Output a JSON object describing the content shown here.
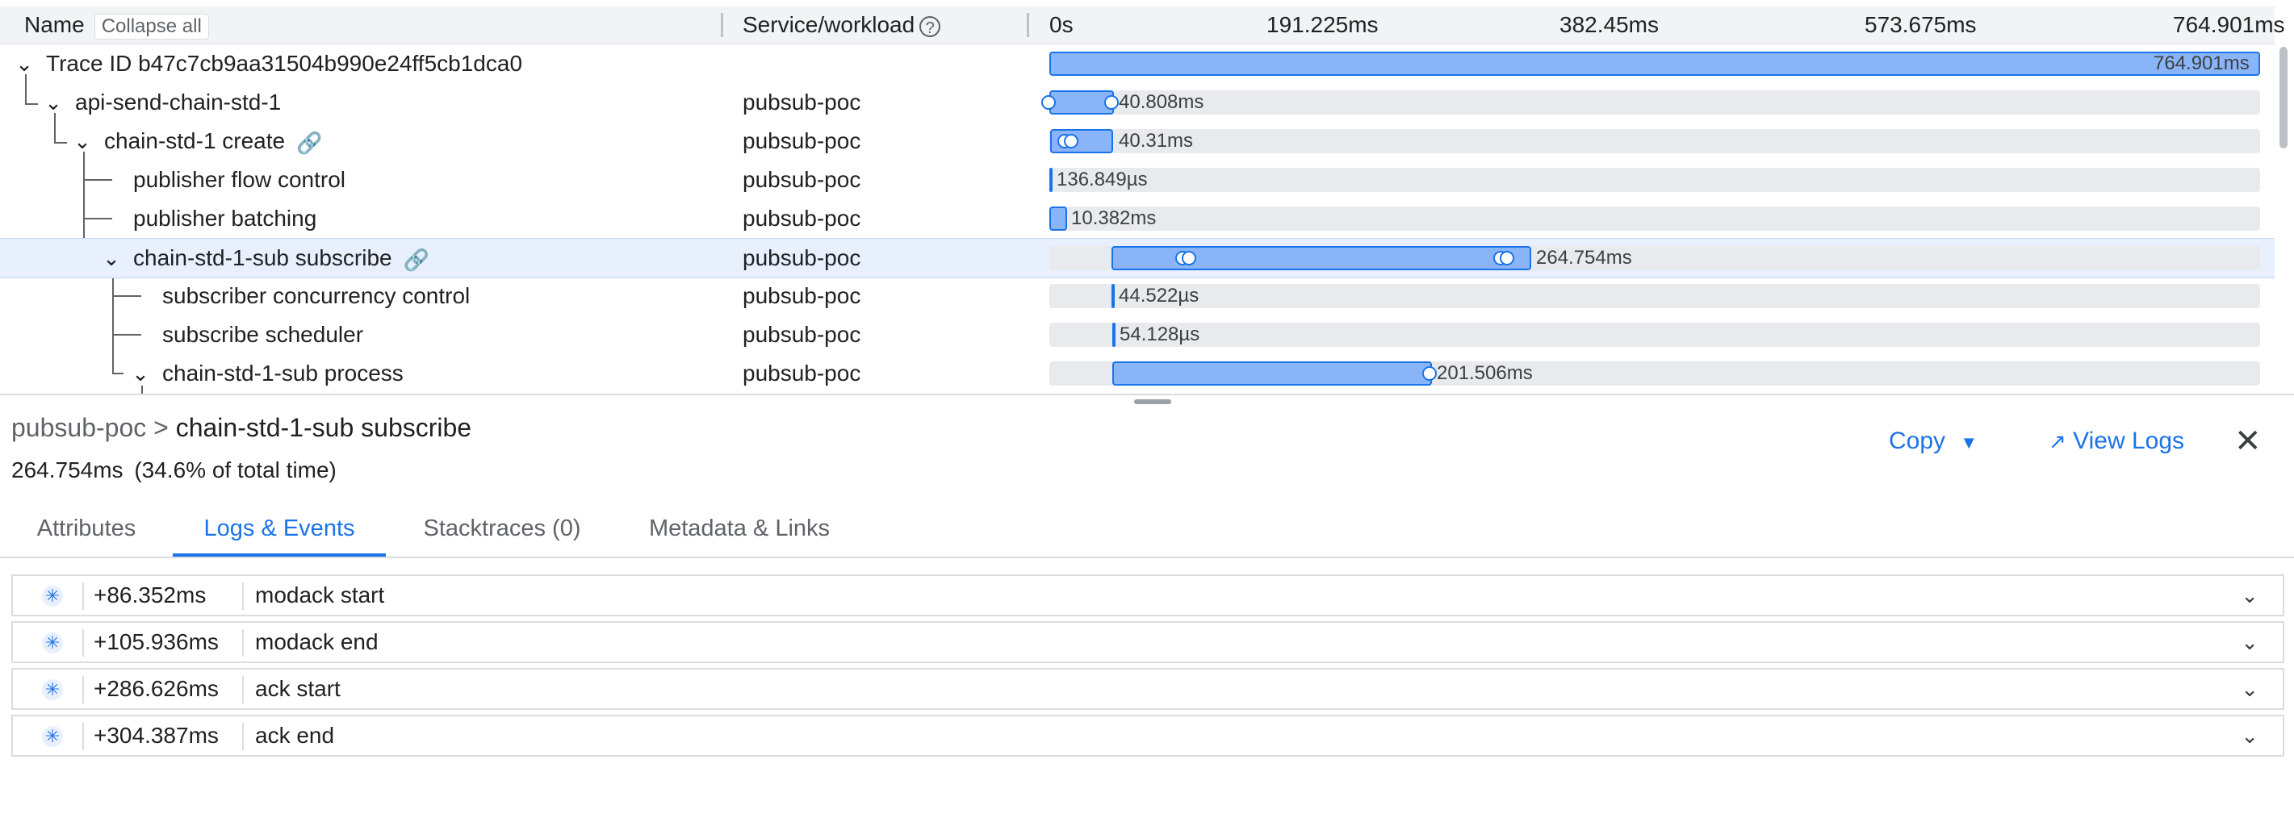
{
  "header": {
    "name_col": "Name",
    "collapse_all": "Collapse all",
    "service_col": "Service/workload",
    "help": "?",
    "ticks": [
      "0s",
      "191.225ms",
      "382.45ms",
      "573.675ms",
      "764.901ms"
    ]
  },
  "rows": [
    {
      "name": "Trace ID b47c7cb9aa31504b990e24ff5cb1dca0",
      "service": "",
      "duration": "764.901ms"
    },
    {
      "name": "api-send-chain-std-1",
      "service": "pubsub-poc",
      "duration": "40.808ms"
    },
    {
      "name": "chain-std-1 create",
      "service": "pubsub-poc",
      "duration": "40.31ms"
    },
    {
      "name": "publisher flow control",
      "service": "pubsub-poc",
      "duration": "136.849µs"
    },
    {
      "name": "publisher batching",
      "service": "pubsub-poc",
      "duration": "10.382ms"
    },
    {
      "name": "chain-std-1-sub subscribe",
      "service": "pubsub-poc",
      "duration": "264.754ms"
    },
    {
      "name": "subscriber concurrency control",
      "service": "pubsub-poc",
      "duration": "44.522µs"
    },
    {
      "name": "subscribe scheduler",
      "service": "pubsub-poc",
      "duration": "54.128µs"
    },
    {
      "name": "chain-std-1-sub process",
      "service": "pubsub-poc",
      "duration": "201.506ms"
    }
  ],
  "detail": {
    "breadcrumb_service": "pubsub-poc",
    "breadcrumb_sep": ">",
    "breadcrumb_span": "chain-std-1-sub subscribe",
    "duration": "264.754ms",
    "percent": "(34.6% of total time)",
    "copy_label": "Copy",
    "view_logs_label": "View Logs",
    "tabs": [
      "Attributes",
      "Logs & Events",
      "Stacktraces (0)",
      "Metadata & Links"
    ],
    "active_tab": "Logs & Events",
    "events": [
      {
        "offset": "+86.352ms",
        "message": "modack start"
      },
      {
        "offset": "+105.936ms",
        "message": "modack end"
      },
      {
        "offset": "+286.626ms",
        "message": "ack start"
      },
      {
        "offset": "+304.387ms",
        "message": "ack end"
      }
    ]
  },
  "colors": {
    "accent": "#1a73e8",
    "bar_fill": "#8ab4f8",
    "track": "#e8eaed",
    "selected_row": "#e8f0fe"
  },
  "icons": [
    "chevron-down-icon",
    "link-icon",
    "help-icon",
    "dropdown-arrow-icon",
    "open-in-new-icon",
    "close-icon",
    "event-icon"
  ]
}
